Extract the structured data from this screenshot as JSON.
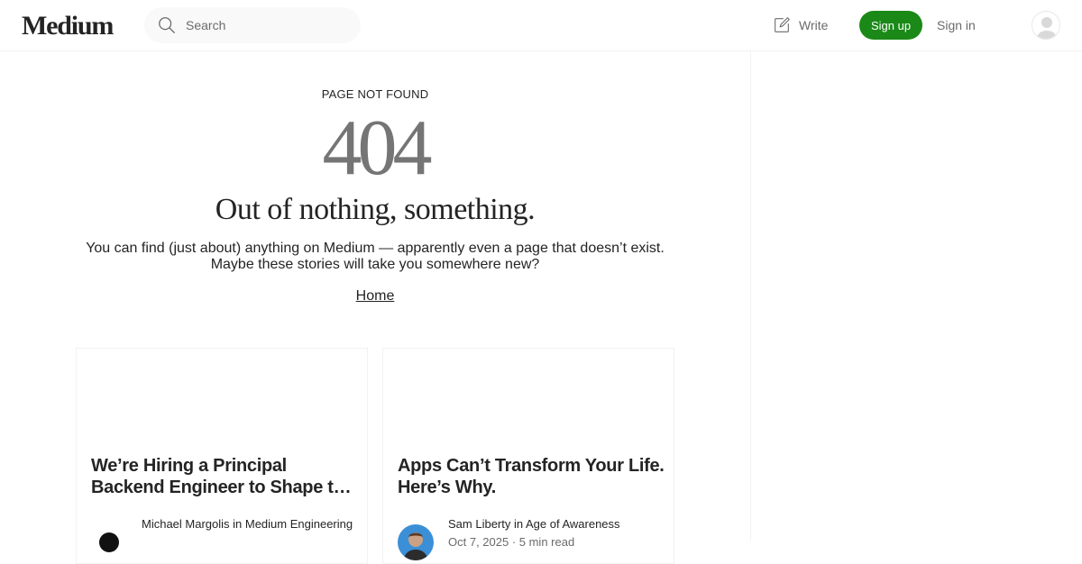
{
  "header": {
    "logo": "Medium",
    "search_placeholder": "Search",
    "write_label": "Write",
    "signup_label": "Sign up",
    "signin_label": "Sign in"
  },
  "main": {
    "kicker": "PAGE NOT FOUND",
    "code": "404",
    "headline": "Out of nothing, something.",
    "description_line1": "You can find (just about) anything on Medium — apparently even a page that doesn’t exist.",
    "description_line2": "Maybe these stories will take you somewhere new?",
    "home_link": "Home"
  },
  "cards": [
    {
      "title": "We’re Hiring a Principal Backend Engineer to Shape the Future of Medium",
      "byline": "Michael Margolis in Medium Engineering",
      "meta": ""
    },
    {
      "title": "Apps Can’t Transform Your Life. Here’s Why.",
      "byline": "Sam Liberty in Age of Awareness",
      "meta": "Oct 7, 2025 · 5 min read"
    }
  ],
  "colors": {
    "brand_green": "#1a8917",
    "text_primary": "#242424",
    "text_secondary": "#6b6b6b",
    "code_gray": "#757575"
  }
}
